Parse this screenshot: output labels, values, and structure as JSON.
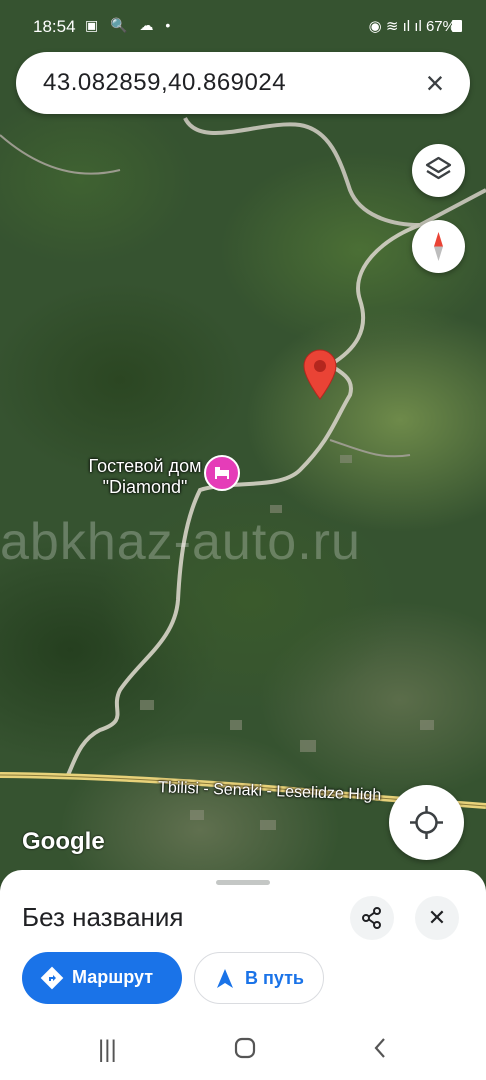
{
  "status_bar": {
    "time": "18:54",
    "left_icons": "▣ 🔍 ☁ •",
    "battery": "67%"
  },
  "search": {
    "query": "43.082859,40.869024"
  },
  "map": {
    "poi": {
      "label": "Гостевой дом \"Diamond\"",
      "icon": "hotel-bed-icon",
      "color": "#e53db8"
    },
    "road_label": "Tbilisi - Senaki - Leselidze High",
    "watermark": "abkhaz-auto.ru",
    "attribution": "Google",
    "pin_color": "#ea4335"
  },
  "sheet": {
    "title": "Без названия",
    "route_button": "Маршрут",
    "go_button": "В путь",
    "accent": "#1a73e8"
  }
}
